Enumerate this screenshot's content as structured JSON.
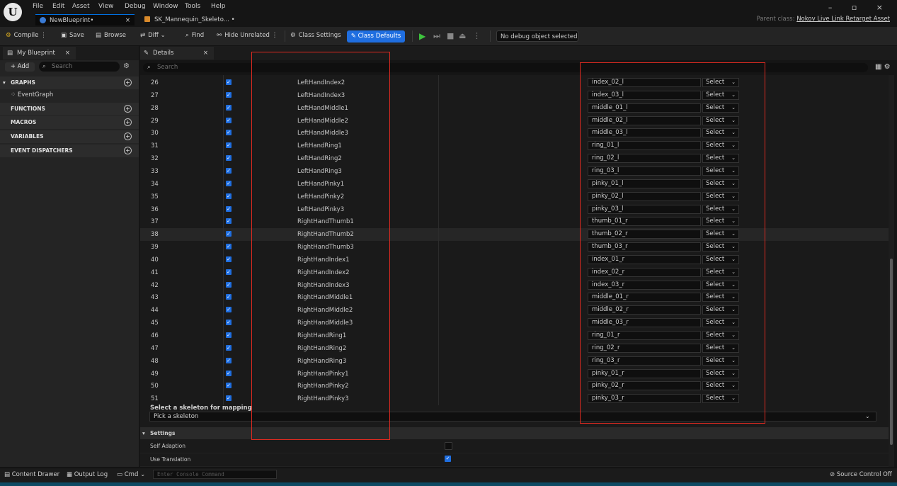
{
  "menu": [
    "File",
    "Edit",
    "Asset",
    "View",
    "Debug",
    "Window",
    "Tools",
    "Help"
  ],
  "tabs": [
    {
      "label": "NewBlueprint•",
      "close": "×"
    },
    {
      "label": "SK_Mannequin_Skeleto... •"
    }
  ],
  "window_controls": "–  ▫  ×",
  "parent_class": {
    "label": "Parent class:",
    "value": "Nokov Live Link Retarget Asset"
  },
  "toolbar": {
    "compile": "Compile",
    "save": "Save",
    "browse": "Browse",
    "diff": "Diff",
    "find": "Find",
    "hide_unrelated": "Hide Unrelated",
    "class_settings": "Class Settings",
    "class_defaults": "Class Defaults",
    "debug_object": "No debug object selected"
  },
  "left_panel": {
    "tab": "My Blueprint",
    "tab_close": "×",
    "add": "+ Add",
    "search_placeholder": "Search",
    "sections": {
      "graphs": "GRAPHS",
      "eventgraph": "EventGraph",
      "functions": "FUNCTIONS",
      "macros": "MACROS",
      "variables": "VARIABLES",
      "event_dispatchers": "EVENT DISPATCHERS"
    }
  },
  "details": {
    "tab": "Details",
    "tab_close": "×",
    "search_placeholder": "Search",
    "select_label": "Select",
    "rows": [
      {
        "index": "26",
        "name": "LeftHandIndex2",
        "value": "index_02_l"
      },
      {
        "index": "27",
        "name": "LeftHandIndex3",
        "value": "index_03_l"
      },
      {
        "index": "28",
        "name": "LeftHandMiddle1",
        "value": "middle_01_l"
      },
      {
        "index": "29",
        "name": "LeftHandMiddle2",
        "value": "middle_02_l"
      },
      {
        "index": "30",
        "name": "LeftHandMiddle3",
        "value": "middle_03_l"
      },
      {
        "index": "31",
        "name": "LeftHandRing1",
        "value": "ring_01_l"
      },
      {
        "index": "32",
        "name": "LeftHandRing2",
        "value": "ring_02_l"
      },
      {
        "index": "33",
        "name": "LeftHandRing3",
        "value": "ring_03_l"
      },
      {
        "index": "34",
        "name": "LeftHandPinky1",
        "value": "pinky_01_l"
      },
      {
        "index": "35",
        "name": "LeftHandPinky2",
        "value": "pinky_02_l"
      },
      {
        "index": "36",
        "name": "LeftHandPinky3",
        "value": "pinky_03_l"
      },
      {
        "index": "37",
        "name": "RightHandThumb1",
        "value": "thumb_01_r"
      },
      {
        "index": "38",
        "name": "RightHandThumb2",
        "value": "thumb_02_r"
      },
      {
        "index": "39",
        "name": "RightHandThumb3",
        "value": "thumb_03_r"
      },
      {
        "index": "40",
        "name": "RightHandIndex1",
        "value": "index_01_r"
      },
      {
        "index": "41",
        "name": "RightHandIndex2",
        "value": "index_02_r"
      },
      {
        "index": "42",
        "name": "RightHandIndex3",
        "value": "index_03_r"
      },
      {
        "index": "43",
        "name": "RightHandMiddle1",
        "value": "middle_01_r"
      },
      {
        "index": "44",
        "name": "RightHandMiddle2",
        "value": "middle_02_r"
      },
      {
        "index": "45",
        "name": "RightHandMiddle3",
        "value": "middle_03_r"
      },
      {
        "index": "46",
        "name": "RightHandRing1",
        "value": "ring_01_r"
      },
      {
        "index": "47",
        "name": "RightHandRing2",
        "value": "ring_02_r"
      },
      {
        "index": "48",
        "name": "RightHandRing3",
        "value": "ring_03_r"
      },
      {
        "index": "49",
        "name": "RightHandPinky1",
        "value": "pinky_01_r"
      },
      {
        "index": "50",
        "name": "RightHandPinky2",
        "value": "pinky_02_r"
      },
      {
        "index": "51",
        "name": "RightHandPinky3",
        "value": "pinky_03_r"
      }
    ],
    "mapping_label": "Select a skeleton for mapping",
    "mapping_value": "Pick a skeleton",
    "settings_header": "Settings",
    "settings": [
      {
        "label": "Self Adaption",
        "checked": false
      },
      {
        "label": "Use Translation",
        "checked": true
      }
    ]
  },
  "statusbar": {
    "content_drawer": "Content Drawer",
    "output_log": "Output Log",
    "cmd": "Cmd",
    "console_placeholder": "Enter Console Command",
    "source_control": "Source Control Off"
  },
  "colors": {
    "accent": "#1f6ee0",
    "highlight_box": "#e02a20",
    "play": "#3ec43e"
  }
}
